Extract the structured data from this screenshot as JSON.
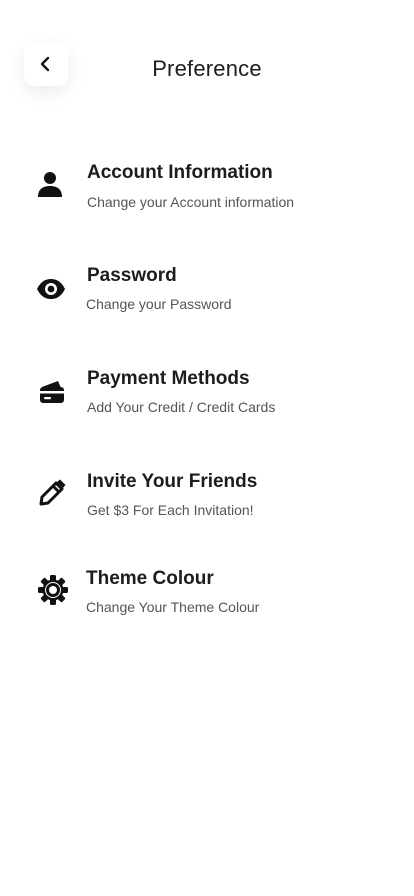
{
  "header": {
    "title": "Preference",
    "back_icon": "chevron-left-icon"
  },
  "menu": [
    {
      "icon": "user-icon",
      "title": "Account Information",
      "subtitle": "Change your Account information"
    },
    {
      "icon": "eye-icon",
      "title": "Password",
      "subtitle": "Change your Password"
    },
    {
      "icon": "credit-card-icon",
      "title": "Payment Methods",
      "subtitle": "Add Your Credit / Credit Cards"
    },
    {
      "icon": "pencil-icon",
      "title": "Invite Your Friends",
      "subtitle": "Get $3 For Each Invitation!"
    },
    {
      "icon": "gear-icon",
      "title": "Theme Colour",
      "subtitle": "Change Your Theme Colour"
    }
  ],
  "colors": {
    "text": "#1d1d1f",
    "subtext": "#555555",
    "background": "#ffffff"
  }
}
